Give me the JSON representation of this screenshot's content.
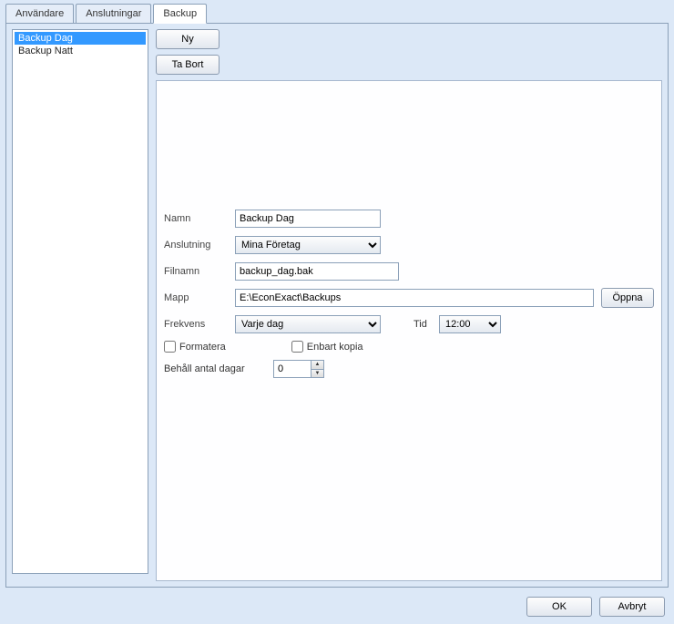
{
  "tabs": {
    "t0": "Användare",
    "t1": "Anslutningar",
    "t2": "Backup"
  },
  "list": {
    "item0": "Backup Dag",
    "item1": "Backup Natt"
  },
  "buttons": {
    "ny": "Ny",
    "tabort": "Ta Bort",
    "oppna": "Öppna",
    "ok": "OK",
    "avbryt": "Avbryt"
  },
  "labels": {
    "namn": "Namn",
    "anslutning": "Anslutning",
    "filnamn": "Filnamn",
    "mapp": "Mapp",
    "frekvens": "Frekvens",
    "tid": "Tid",
    "formatera": "Formatera",
    "enbart_kopia": "Enbart kopia",
    "behall": "Behåll antal dagar"
  },
  "values": {
    "namn": "Backup Dag",
    "anslutning": "Mina Företag",
    "filnamn": "backup_dag.bak",
    "mapp": "E:\\EconExact\\Backups",
    "frekvens": "Varje dag",
    "tid": "12:00",
    "behall": "0"
  }
}
